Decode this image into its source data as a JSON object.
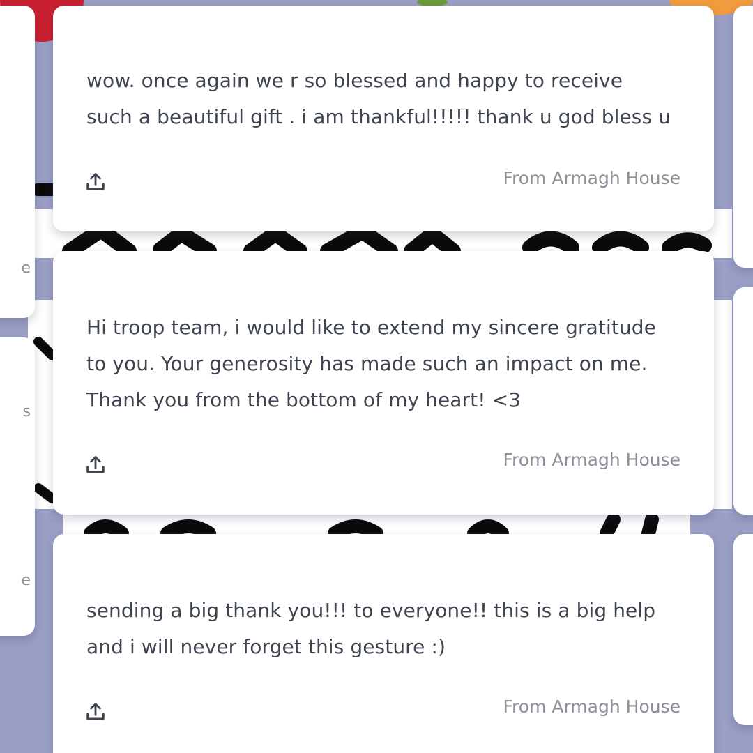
{
  "messages": [
    {
      "text_lines": [
        "wow. once again we r so blessed and happy to receive",
        "such a beautiful gift . i am thankful!!!!! thank u god bless u"
      ],
      "from": "From Armagh House",
      "share_icon": "share-upload-icon"
    },
    {
      "text_lines": [
        "Hi troop team, i would like to extend my sincere gratitude",
        "to you. Your generosity has made such an impact on me.",
        "Thank you from the bottom of my heart! <3"
      ],
      "from": "From Armagh House",
      "share_icon": "share-upload-icon"
    },
    {
      "text_lines": [
        "sending a big thank you!!! to everyone!! this is a big help",
        "and i will never forget this gesture :)"
      ],
      "from": "From Armagh House",
      "share_icon": "share-upload-icon"
    }
  ],
  "colors": {
    "background": "#9b9fc6",
    "card": "#ffffff",
    "message_text": "#3e4450",
    "from_text": "#8c9099",
    "artwork_ink": "#0b0b0b",
    "flower_red": "#c8202f",
    "flower_orange": "#f29b3c",
    "leaf_green": "#6a9b3a"
  }
}
